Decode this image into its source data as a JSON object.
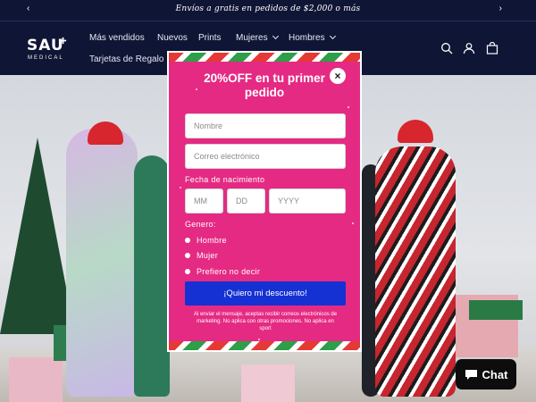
{
  "announcement": {
    "text": "Envíos a gratis en pedidos de $2,000 o más",
    "prev_icon": "chevron-left-icon",
    "next_icon": "chevron-right-icon"
  },
  "header": {
    "logo_text": "SAU",
    "logo_subtext": "MEDICAL",
    "nav": [
      {
        "label": "Más vendidos"
      },
      {
        "label": "Nuevos"
      },
      {
        "label": "Prints"
      },
      {
        "label": "Mujeres"
      },
      {
        "label": "Hombres"
      },
      {
        "label": "Tarjetas de Regalo"
      }
    ],
    "icons": [
      "search-icon",
      "account-icon",
      "cart-icon"
    ],
    "colors": {
      "background": "#0f1535",
      "text": "#ffffff"
    }
  },
  "popup": {
    "title": "20%OFF en tu primer pedido",
    "close_label": "×",
    "name_placeholder": "Nombre",
    "email_placeholder": "Correo electrónico",
    "birthdate_label": "Fecha de nacimiento",
    "month_placeholder": "MM",
    "day_placeholder": "DD",
    "year_placeholder": "YYYY",
    "gender_label": "Genero:",
    "gender_options": [
      "Hombre",
      "Mujer",
      "Prefiero no decir"
    ],
    "submit_label": "¡Quiero mi descuento!",
    "disclaimer": "Al enviar el mensaje, aceptas recibir correos electrónicos de marketing. No aplica con otras promociones. No aplica en sport",
    "colors": {
      "background": "#e52a83",
      "button": "#1531d3"
    }
  },
  "chat": {
    "label": "Chat",
    "icon": "chat-bubble-icon"
  }
}
